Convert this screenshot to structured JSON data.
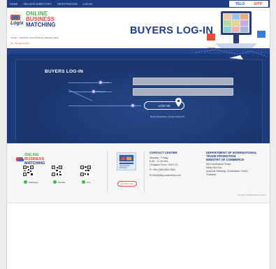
{
  "nav": {
    "links": [
      "HOME",
      "SELLERS DIRECTORY",
      "REGISTRATION",
      "LOG-IN"
    ],
    "brand_logo_1": "TELO",
    "brand_logo_2": "DITP"
  },
  "header": {
    "logo": {
      "tel": "TEL",
      "logix": "Logix",
      "online": "ONLINE",
      "business": "BUSINESS",
      "matching": "MATCHING"
    },
    "tagline": "TILOG - LOGISTIX Online Business Matching 2023",
    "dates": "28 - 31 August 2023"
  },
  "page_title": "BUYERS LOG-IN",
  "form": {
    "title": "BUYERS LOG-IN",
    "email_label": "E-mail",
    "password_label": "Password",
    "login_label": "LOG-IN",
    "buyers_registration": "Buyers Registration",
    "forgot_password": "Forgot password?"
  },
  "footer": {
    "logo": {
      "online": "ONLINE",
      "business": "BUSINESS",
      "matching": "MATCHING"
    },
    "social": [
      "Whatsapp",
      "Wechat",
      "Line"
    ],
    "download_label": "DOWNLOAD",
    "contact": {
      "title": "CONTACT CENTER",
      "hours": [
        "Monday - Friday",
        "9.00 - 17.00 Hrs.",
        "(Thailand Time: GMT+7)"
      ],
      "phone": "+66 (0)89-089-7804",
      "email": "info@tilog-matching.com"
    },
    "department": {
      "title_lines": [
        "DEPARTMENT OF INTERNATIONAL",
        "TRADE PROMOTION",
        "MINISTRY OF COMMERCE"
      ],
      "address": [
        "563 Nonthaburi Road,",
        "Bang Kra Sor,",
        "Amphoe Mueang, Nonthaburi 11000,",
        "Thailand"
      ]
    },
    "copyright": "Copyright ©2023 All rights reserved"
  },
  "colors": {
    "navy": "#1e3c82",
    "red": "#e84a3b",
    "green": "#4cb050",
    "hero": "#1c3a78"
  }
}
